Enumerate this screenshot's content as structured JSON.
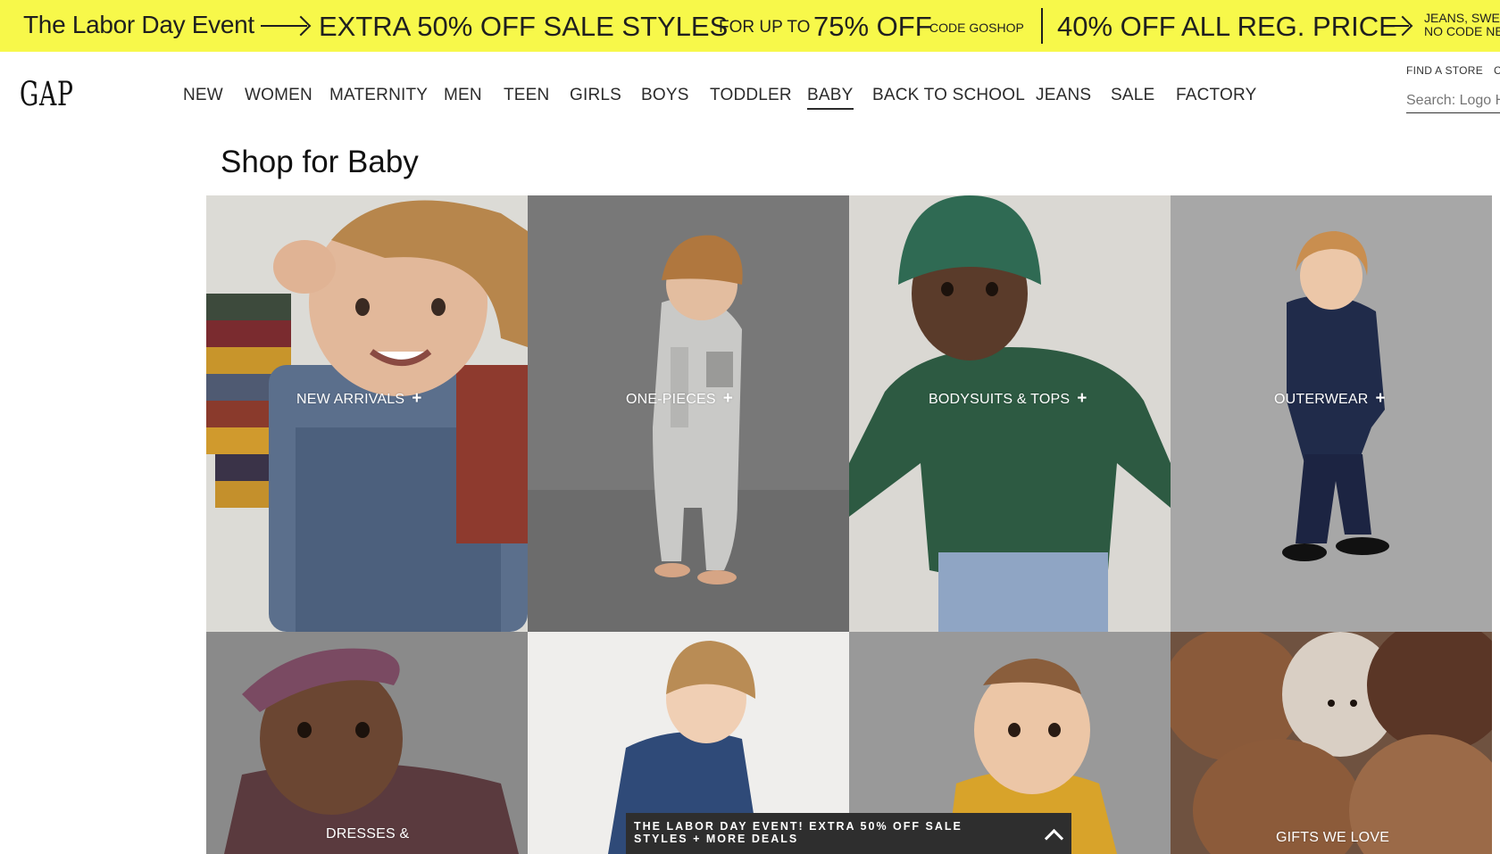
{
  "promo": {
    "event": "The Labor Day Event",
    "extra": "EXTRA 50% OFF SALE STYLES",
    "for_up_to": "FOR UP TO",
    "pct75": "75% OFF",
    "code": "CODE GOSHOP",
    "pct40": "40% OFF",
    "all_reg": "ALL REG. PRICE",
    "jeans_line1": "JEANS, SWE",
    "jeans_line2": "NO CODE NE",
    "background": "#f7f84a"
  },
  "header": {
    "logo": "GAP",
    "nav": [
      "NEW",
      "WOMEN",
      "MATERNITY",
      "MEN",
      "TEEN",
      "GIRLS",
      "BOYS",
      "TODDLER",
      "BABY",
      "BACK TO SCHOOL",
      "JEANS",
      "SALE",
      "FACTORY"
    ],
    "active_nav": "BABY",
    "find_store": "FIND A STORE",
    "find_store_overflow": "C",
    "search_placeholder": "Search: Logo H"
  },
  "page_title": "Shop for Baby",
  "tiles": [
    {
      "label": "NEW ARRIVALS",
      "icon": "plus-icon"
    },
    {
      "label": "ONE-PIECES",
      "icon": "plus-icon"
    },
    {
      "label": "BODYSUITS & TOPS",
      "icon": "plus-icon"
    },
    {
      "label": "OUTERWEAR",
      "icon": "plus-icon"
    },
    {
      "label": "DRESSES &",
      "icon": ""
    },
    {
      "label": "",
      "icon": ""
    },
    {
      "label": "",
      "icon": ""
    },
    {
      "label": "GIFTS WE LOVE",
      "icon": ""
    }
  ],
  "deals_banner": {
    "text": "THE LABOR DAY EVENT! EXTRA 50% OFF SALE STYLES + MORE DEALS",
    "icon": "chevron-up-icon"
  }
}
